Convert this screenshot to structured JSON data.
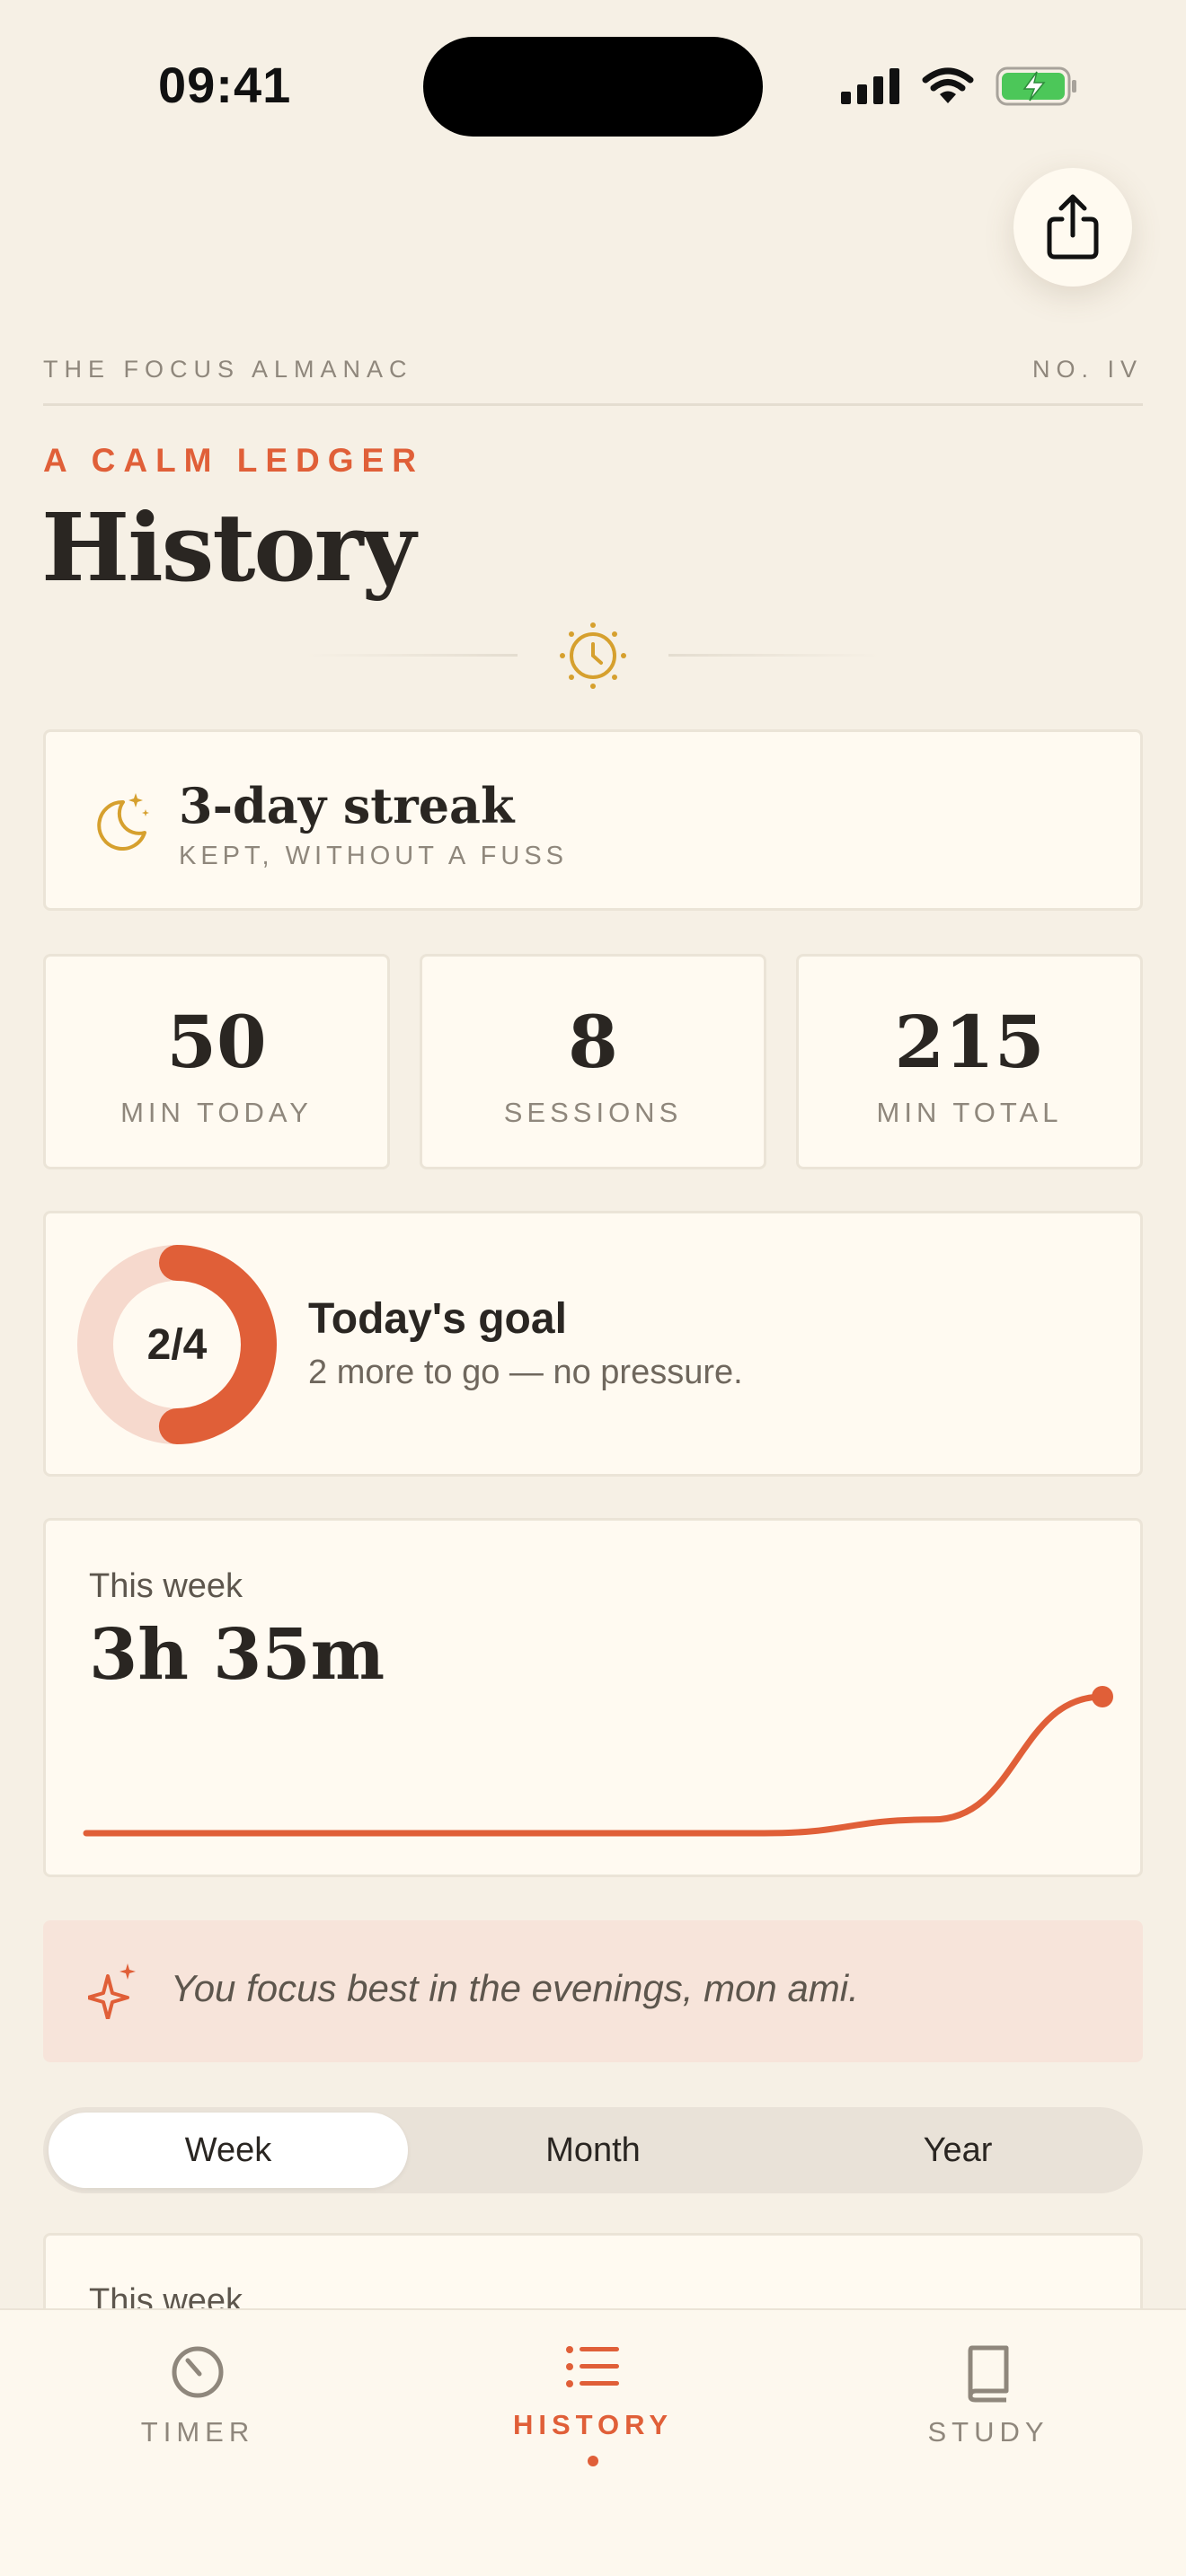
{
  "status": {
    "time": "09:41"
  },
  "masthead": {
    "publication": "THE FOCUS ALMANAC",
    "issue": "NO. IV"
  },
  "header": {
    "eyebrow": "A CALM LEDGER",
    "title": "History"
  },
  "streak": {
    "title": "3-day streak",
    "subtitle": "KEPT, WITHOUT A FUSS"
  },
  "stats": [
    {
      "value": "50",
      "label": "MIN TODAY"
    },
    {
      "value": "8",
      "label": "SESSIONS"
    },
    {
      "value": "215",
      "label": "MIN TOTAL"
    }
  ],
  "goal": {
    "progress_label": "2/4",
    "completed": 2,
    "target": 4,
    "title": "Today's goal",
    "subtitle": "2 more to go — no pressure."
  },
  "week": {
    "label": "This week",
    "total": "3h 35m",
    "chart_data": {
      "type": "line",
      "x": [
        1,
        2,
        3,
        4,
        5,
        6,
        7
      ],
      "values": [
        0,
        0,
        0,
        0,
        0,
        5,
        50
      ],
      "ylim": [
        0,
        60
      ]
    }
  },
  "insight": {
    "text": "You focus best in the evenings, mon ami."
  },
  "range_tabs": [
    {
      "label": "Week",
      "active": true
    },
    {
      "label": "Month",
      "active": false
    },
    {
      "label": "Year",
      "active": false
    }
  ],
  "peek": {
    "label": "This week"
  },
  "tabbar": [
    {
      "label": "TIMER",
      "icon": "timer-icon",
      "active": false
    },
    {
      "label": "HISTORY",
      "icon": "list-icon",
      "active": true
    },
    {
      "label": "STUDY",
      "icon": "book-icon",
      "active": false
    }
  ],
  "colors": {
    "accent": "#e05f38",
    "gold": "#d6a02e",
    "background": "#f6f0e5",
    "card": "#fffaf1"
  }
}
